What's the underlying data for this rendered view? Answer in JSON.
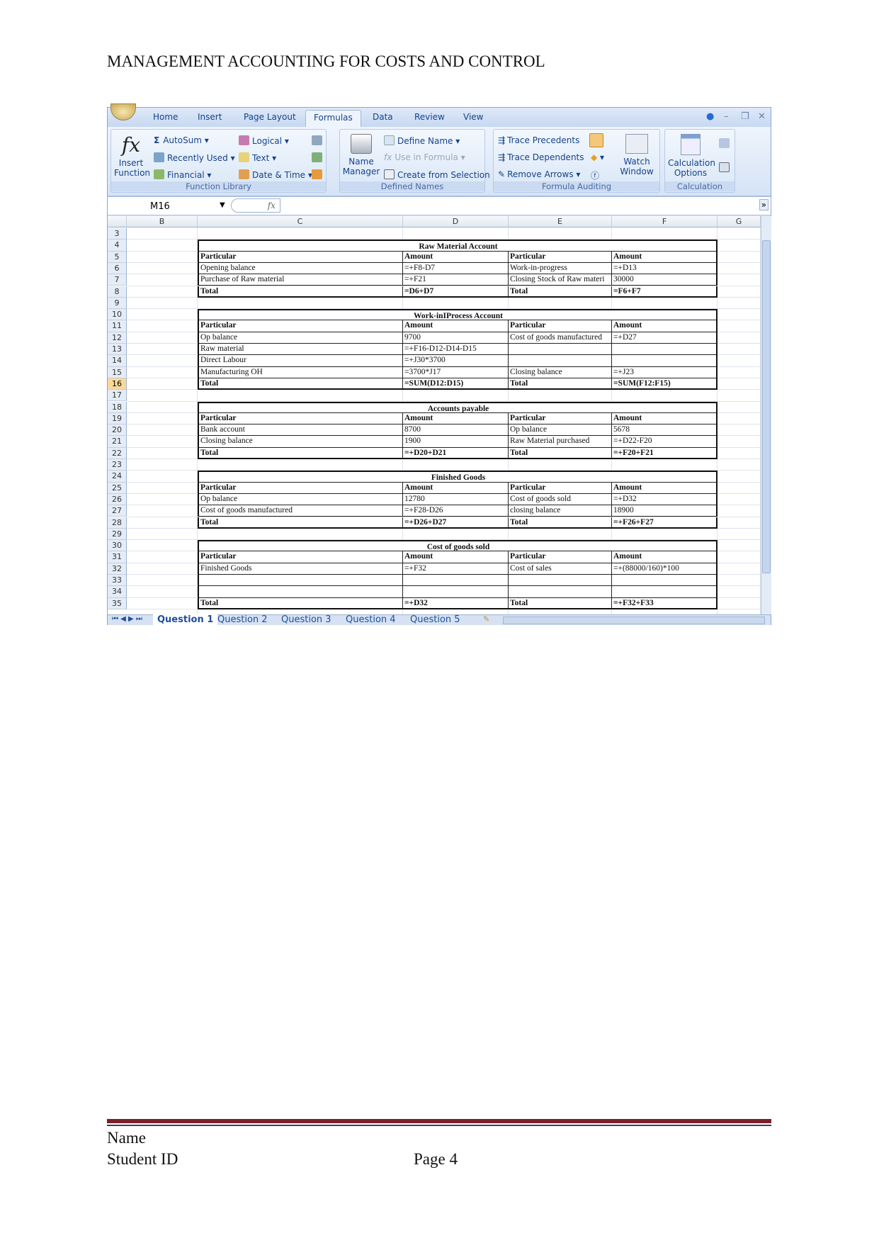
{
  "document": {
    "title": "MANAGEMENT ACCOUNTING FOR COSTS AND CONTROL"
  },
  "ribbon": {
    "tabs": [
      "Home",
      "Insert",
      "Page Layout",
      "Formulas",
      "Data",
      "Review",
      "View"
    ],
    "active_tab": "Formulas",
    "groups": {
      "function_library": {
        "label": "Function Library",
        "insert_function": "Insert Function",
        "autosum": "AutoSum",
        "recently_used": "Recently Used",
        "financial": "Financial",
        "logical": "Logical",
        "text": "Text",
        "date_time": "Date & Time"
      },
      "defined_names": {
        "label": "Defined Names",
        "name_manager": "Name Manager",
        "define_name": "Define Name",
        "use_in_formula": "Use in Formula",
        "create_from_selection": "Create from Selection"
      },
      "formula_auditing": {
        "label": "Formula Auditing",
        "trace_precedents": "Trace Precedents",
        "trace_dependents": "Trace Dependents",
        "remove_arrows": "Remove Arrows",
        "watch_window": "Watch Window"
      },
      "calculation": {
        "label": "Calculation",
        "calculation_options": "Calculation Options"
      }
    }
  },
  "formula_bar": {
    "name_box": "M16",
    "fx": "fx",
    "value": ""
  },
  "sheet": {
    "columns": [
      "B",
      "C",
      "D",
      "E",
      "F",
      "G"
    ],
    "selected_row": 16,
    "rows": [
      {
        "n": 3,
        "type": "blank"
      },
      {
        "n": 4,
        "type": "title",
        "cells": [
          "Raw Material Account"
        ]
      },
      {
        "n": 5,
        "type": "header",
        "cells": [
          "Particular",
          "Amount",
          "Particular",
          "Amount"
        ]
      },
      {
        "n": 6,
        "type": "data",
        "cells": [
          "Opening balance",
          "=+F8-D7",
          "Work-in-progress",
          "=+D13"
        ]
      },
      {
        "n": 7,
        "type": "data",
        "cells": [
          "Purchase of Raw material",
          "=+F21",
          "Closing Stock of Raw materi",
          "30000"
        ]
      },
      {
        "n": 8,
        "type": "total",
        "cells": [
          "Total",
          "=D6+D7",
          "Total",
          "=F6+F7"
        ]
      },
      {
        "n": 9,
        "type": "blank"
      },
      {
        "n": 10,
        "type": "title",
        "cells": [
          "Work-inIProcess Account"
        ]
      },
      {
        "n": 11,
        "type": "header",
        "cells": [
          "Particular",
          "Amount",
          "Particular",
          "Amount"
        ]
      },
      {
        "n": 12,
        "type": "data",
        "cells": [
          "Op balance",
          "9700",
          "Cost of goods manufactured",
          "=+D27"
        ]
      },
      {
        "n": 13,
        "type": "data",
        "cells": [
          "Raw material",
          "=+F16-D12-D14-D15",
          "",
          ""
        ]
      },
      {
        "n": 14,
        "type": "data",
        "cells": [
          "Direct Labour",
          "=+J30*3700",
          "",
          ""
        ]
      },
      {
        "n": 15,
        "type": "data",
        "cells": [
          "Manufacturing OH",
          "=3700*J17",
          "Closing balance",
          "=+J23"
        ]
      },
      {
        "n": 16,
        "type": "total",
        "cells": [
          "Total",
          "=SUM(D12:D15)",
          "Total",
          "=SUM(F12:F15)"
        ]
      },
      {
        "n": 17,
        "type": "blank"
      },
      {
        "n": 18,
        "type": "title",
        "cells": [
          "Accounts payable"
        ]
      },
      {
        "n": 19,
        "type": "header",
        "cells": [
          "Particular",
          "Amount",
          "Particular",
          "Amount"
        ]
      },
      {
        "n": 20,
        "type": "data",
        "cells": [
          "Bank account",
          "8700",
          "Op balance",
          "5678"
        ]
      },
      {
        "n": 21,
        "type": "data",
        "cells": [
          "Closing balance",
          "1900",
          "Raw Material purchased",
          "=+D22-F20"
        ]
      },
      {
        "n": 22,
        "type": "total",
        "cells": [
          "Total",
          "=+D20+D21",
          "Total",
          "=+F20+F21"
        ]
      },
      {
        "n": 23,
        "type": "blank"
      },
      {
        "n": 24,
        "type": "title",
        "cells": [
          "Finished Goods"
        ]
      },
      {
        "n": 25,
        "type": "header",
        "cells": [
          "Particular",
          "Amount",
          "Particular",
          "Amount"
        ]
      },
      {
        "n": 26,
        "type": "data",
        "cells": [
          "Op balance",
          "12780",
          "Cost of goods sold",
          "=+D32"
        ]
      },
      {
        "n": 27,
        "type": "data",
        "cells": [
          "Cost of goods manufactured",
          "=+F28-D26",
          "closing balance",
          "18900"
        ]
      },
      {
        "n": 28,
        "type": "total",
        "cells": [
          "Total",
          "=+D26+D27",
          "Total",
          "=+F26+F27"
        ]
      },
      {
        "n": 29,
        "type": "blank"
      },
      {
        "n": 30,
        "type": "title",
        "cells": [
          "Cost of goods sold"
        ]
      },
      {
        "n": 31,
        "type": "header",
        "cells": [
          "Particular",
          "Amount",
          "Particular",
          "Amount"
        ]
      },
      {
        "n": 32,
        "type": "data",
        "cells": [
          "Finished Goods",
          "=+F32",
          "Cost of sales",
          "=+(88000/160)*100"
        ]
      },
      {
        "n": 33,
        "type": "data",
        "cells": [
          "",
          "",
          "",
          ""
        ]
      },
      {
        "n": 34,
        "type": "data",
        "cells": [
          "",
          "",
          "",
          ""
        ]
      },
      {
        "n": 35,
        "type": "total",
        "cells": [
          "Total",
          "=+D32",
          "Total",
          "=+F32+F33"
        ]
      }
    ],
    "sheet_tabs": [
      "Question 1",
      "Question 2",
      "Question 3",
      "Question 4",
      "Question 5"
    ],
    "active_sheet": "Question 1"
  },
  "footer": {
    "name": "Name",
    "student_id": "Student ID",
    "page": "Page 4"
  },
  "colors": {
    "ribbon_text": "#15428b",
    "footer_rule": "#7b1f2a",
    "selected_row": "#f9d99a"
  }
}
